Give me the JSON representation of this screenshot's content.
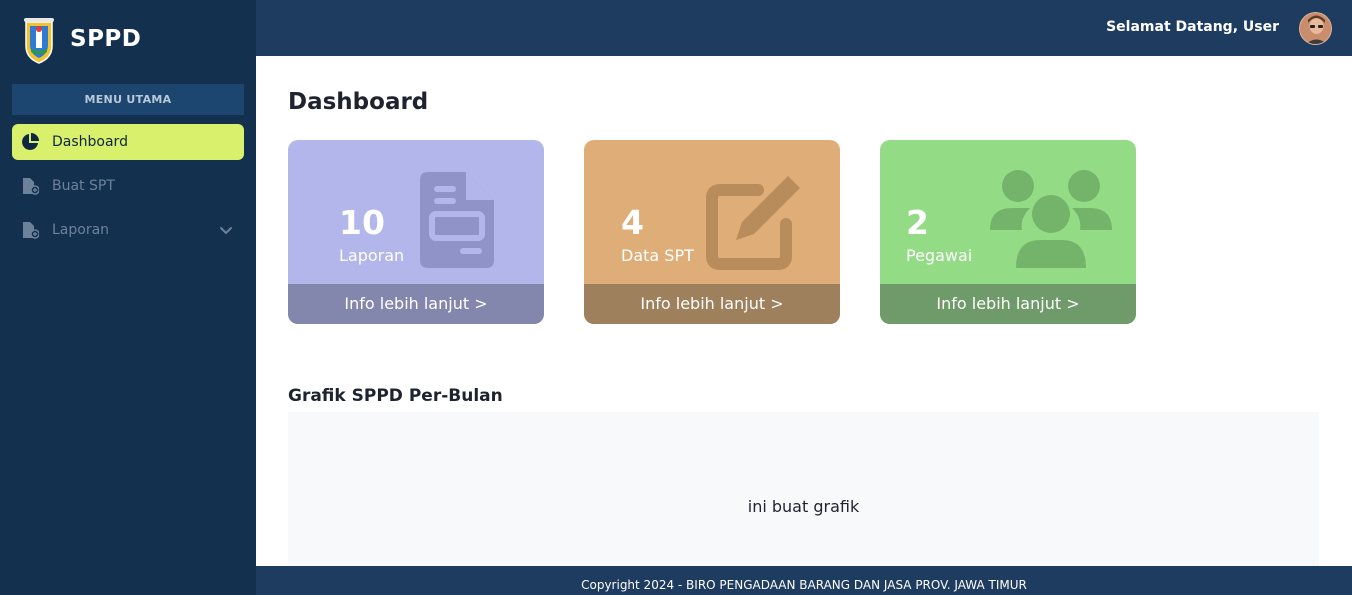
{
  "brand": {
    "name": "SPPD",
    "logo_icon": "provincial-crest-icon"
  },
  "sidebar": {
    "menu_header": "MENU UTAMA",
    "items": [
      {
        "label": "Dashboard",
        "icon": "pie-chart-icon",
        "active": true
      },
      {
        "label": "Buat SPT",
        "icon": "file-plus-icon",
        "active": false
      },
      {
        "label": "Laporan",
        "icon": "file-plus-icon",
        "active": false,
        "has_submenu": true
      }
    ]
  },
  "topbar": {
    "welcome": "Selamat Datang, User",
    "avatar_icon": "user-avatar"
  },
  "page": {
    "title": "Dashboard"
  },
  "cards": [
    {
      "count": "10",
      "label": "Laporan",
      "link": "Info lebih lanjut >",
      "icon": "document-icon",
      "color": "#b3b6ea"
    },
    {
      "count": "4",
      "label": "Data SPT",
      "link": "Info lebih lanjut >",
      "icon": "edit-icon",
      "color": "#dfae78"
    },
    {
      "count": "2",
      "label": "Pegawai",
      "link": "Info lebih lanjut >",
      "icon": "users-icon",
      "color": "#93dc85"
    }
  ],
  "chart": {
    "title": "Grafik SPPD Per-Bulan",
    "placeholder": "ini buat grafik"
  },
  "footer": {
    "text": "Copyright 2024 - BIRO PENGADAAN BARANG DAN JASA PROV. JAWA TIMUR"
  },
  "colors": {
    "sidebar": "#13304f",
    "topbar": "#1d3c60",
    "active_item": "#d8f06c"
  }
}
